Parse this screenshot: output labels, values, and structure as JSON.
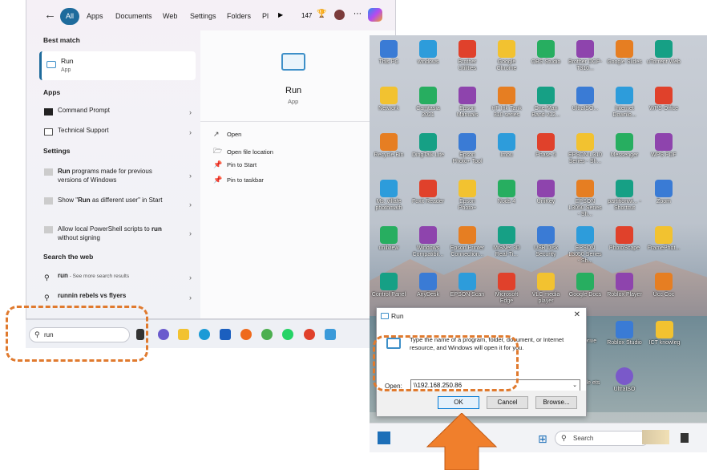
{
  "search": {
    "filters": [
      "All",
      "Apps",
      "Documents",
      "Web",
      "Settings",
      "Folders",
      "Pl"
    ],
    "count": "147",
    "sections": {
      "best_match": "Best match",
      "apps": "Apps",
      "settings": "Settings",
      "search_web": "Search the web"
    },
    "best": {
      "title": "Run",
      "sub": "App"
    },
    "apps": [
      "Command Prompt",
      "Technical Support"
    ],
    "settings_items": [
      {
        "bold": "Run",
        "rest": " programs made for previous versions of Windows"
      },
      {
        "pre": "Show \"",
        "bold": "Run",
        "rest": " as different user\" in Start"
      },
      {
        "pre": "Allow local PowerShell scripts to ",
        "bold": "run",
        "rest": " without signing"
      }
    ],
    "web": [
      {
        "bold": "run",
        "rest": " - See more search results"
      },
      {
        "bold": "runnin rebels vs flyers",
        "rest": ""
      }
    ],
    "preview": {
      "title": "Run",
      "sub": "App"
    },
    "actions": [
      "Open",
      "Open file location",
      "Pin to Start",
      "Pin to taskbar"
    ],
    "query": "run"
  },
  "desktop": {
    "icons": [
      [
        "This PC",
        "windows",
        "Brother Utilities",
        "Google Chrome",
        "OBS Studio",
        "Brother DCP-T310...",
        "Google Slides",
        "uTorrent Web"
      ],
      [
        "Network",
        "Camtasia 2021",
        "Epson Manuals",
        "HP Ink Tank 310 series",
        "One-Man Band v12...",
        "UltraISO...",
        "Internet Downlo...",
        "WPS Office"
      ],
      [
        "Recycle Bin",
        "DingTalk Lite",
        "Epson Photo+ Tool",
        "Imou",
        "Phase 5",
        "EPSON L310 Series - Sh...",
        "Messenger",
        "WPS PDF"
      ],
      [
        "Ms. villafe phothmath",
        "Foxit Reader",
        "Epson Photo+",
        "Nods 4",
        "UniKey",
        "EPSON L3050 Series - Sh...",
        "partitionwi... - Shortcut",
        "Zoom"
      ],
      [
        "unilview",
        "Windows Compatibil...",
        "Epson Printer Connection...",
        "MiSNet 3D Real-Ti...",
        "USB Disk Security",
        "EPSON L3050 Series - Sh...",
        "PhotoScape",
        "FramePhot..."
      ],
      [
        "Control Panel",
        "AnyDesk",
        "EPSON Scan",
        "Microsoft Edge",
        "VLC media player",
        "Google Docs",
        "Roblox Player",
        "Ucc Coc"
      ]
    ],
    "extra_icons": [
      "Drive",
      "Roblox Studio",
      "ICT knowleg",
      "ogle ets",
      "UltraISO"
    ],
    "taskbar_search": "Search"
  },
  "run_dialog": {
    "title": "Run",
    "description": "Type the name of a program, folder, document, or Internet resource, and Windows will open it for you.",
    "open_label": "Open:",
    "open_value": "\\\\192.168.250.86",
    "ok": "OK",
    "cancel": "Cancel",
    "browse": "Browse..."
  },
  "colors": {
    "accent": "#1e6b9c",
    "callout": "#e07a2e",
    "arrow": "#f07f2c"
  }
}
